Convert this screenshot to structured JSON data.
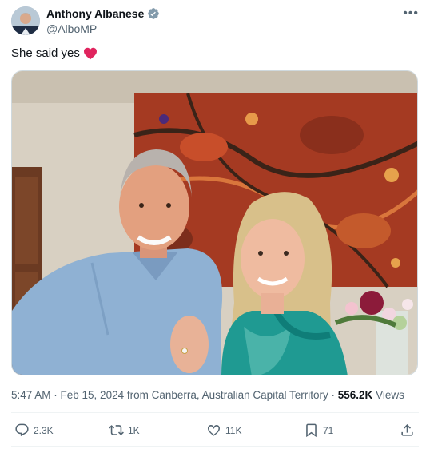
{
  "author": {
    "display_name": "Anthony Albanese",
    "handle": "@AlboMP",
    "verified": true,
    "avatar_icon": "profile-photo"
  },
  "tweet": {
    "text": "She said yes",
    "emoji": "red-heart"
  },
  "meta": {
    "timestamp": "5:47 AM · Feb 15, 2024",
    "location": "from Canberra, Australian Capital Territory",
    "separator": "·",
    "views_count": "556.2K",
    "views_label": "Views"
  },
  "actions": {
    "replies": "2.3K",
    "reposts": "1K",
    "likes": "11K",
    "bookmarks": "71"
  },
  "colors": {
    "text_primary": "#0f1419",
    "text_secondary": "#536471",
    "verified": "#829aab",
    "heart": "#e0245e"
  }
}
